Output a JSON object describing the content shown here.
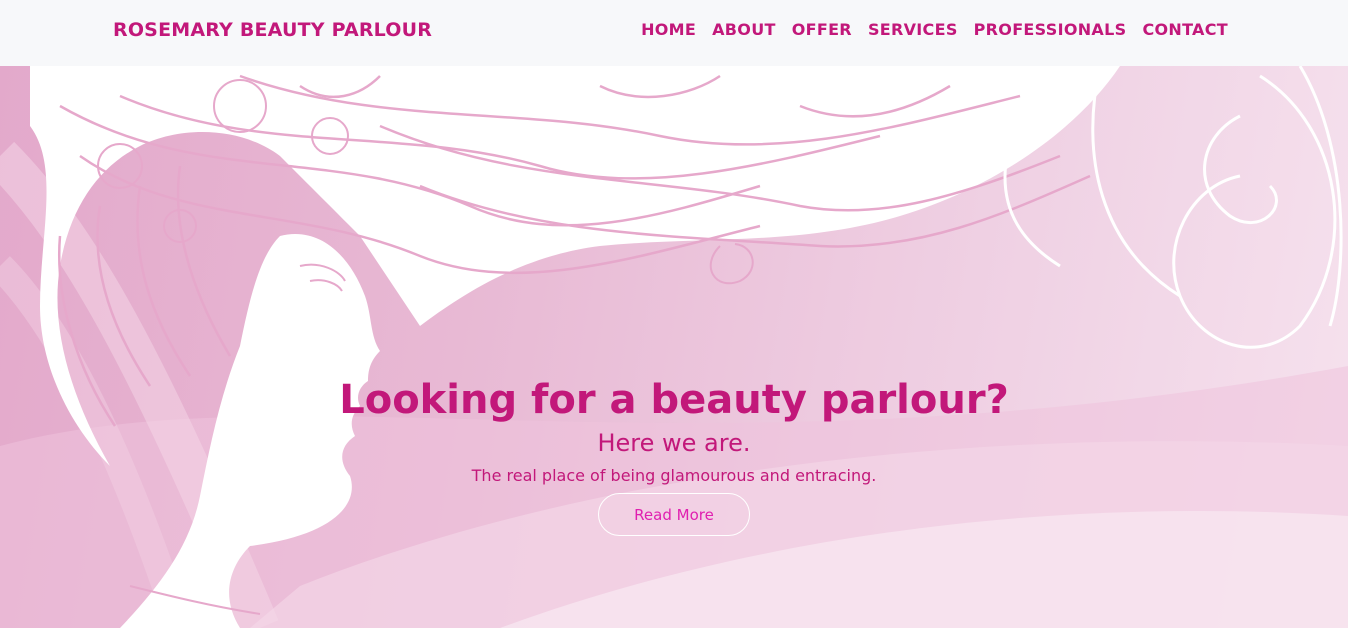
{
  "navbar": {
    "brand": "ROSEMARY BEAUTY PARLOUR",
    "links": [
      "HOME",
      "ABOUT",
      "OFFER",
      "SERVICES",
      "PROFESSIONALS",
      "CONTACT"
    ]
  },
  "hero": {
    "title": "Looking for a beauty parlour?",
    "subtitle": "Here we are.",
    "tagline": "The real place of being glamourous and entracing.",
    "button_label": "Read More",
    "background_image": "woman-profile-flowing-hair-illustration"
  },
  "colors": {
    "accent": "#c2187a",
    "button_text": "#e020b0",
    "navbar_bg": "#f7f8fa",
    "hero_bg": "#e8b9d4"
  }
}
